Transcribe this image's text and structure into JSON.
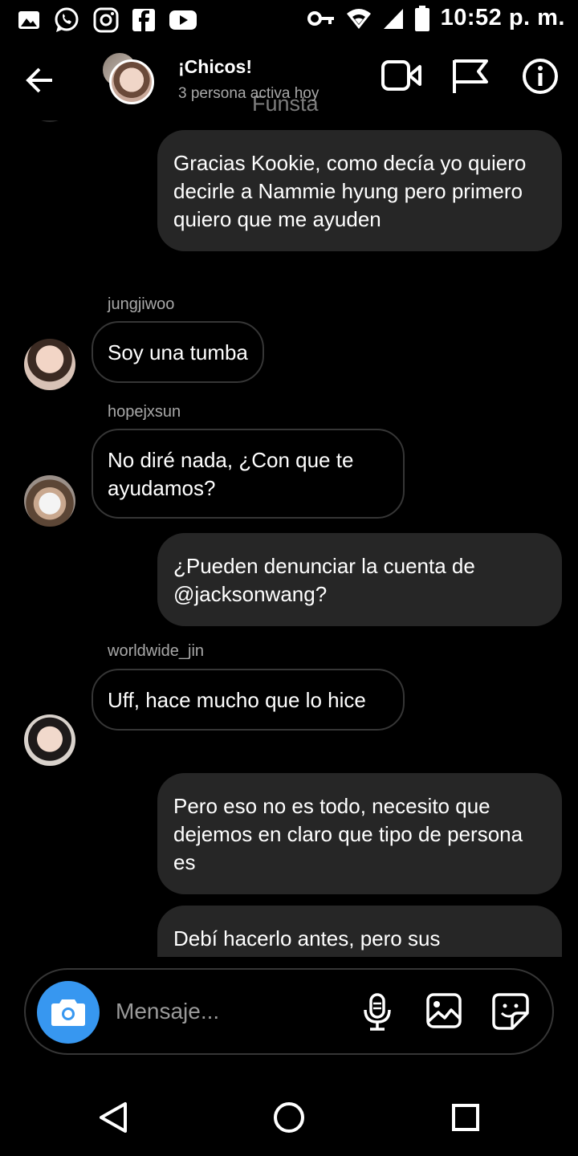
{
  "status_bar": {
    "time": "10:52 p. m.",
    "left_icons": [
      "gallery-notification-icon",
      "whatsapp-icon",
      "instagram-icon",
      "facebook-icon",
      "youtube-icon"
    ],
    "right_icons": [
      "key-icon",
      "wifi-icon",
      "signal-icon",
      "battery-icon"
    ]
  },
  "header": {
    "title": "¡Chicos!",
    "subtitle": "3 persona activa hoy",
    "ghost_text": "Funsta"
  },
  "messages": [
    {
      "type": "outgoing",
      "text": "Gracias Kookie, como decía yo quiero decirle a Nammie hyung pero primero quiero que me ayuden"
    },
    {
      "type": "incoming",
      "sender": "jungjiwoo",
      "text": "Soy una tumba"
    },
    {
      "type": "incoming",
      "sender": "hopejxsun",
      "text": "No diré nada, ¿Con que te ayudamos?"
    },
    {
      "type": "outgoing",
      "text": "¿Pueden denunciar la cuenta de @jacksonwang?"
    },
    {
      "type": "incoming",
      "sender": "worldwide_jin",
      "text": "Uff, hace mucho que lo hice"
    },
    {
      "type": "outgoing",
      "text": "Pero eso no es todo, necesito que dejemos en claro que tipo de persona es"
    },
    {
      "type": "outgoing",
      "text": "Debí hacerlo antes, pero sus"
    }
  ],
  "composer": {
    "placeholder": "Mensaje..."
  },
  "colors": {
    "background": "#000000",
    "outgoing_bubble": "#262626",
    "incoming_border": "#363636",
    "camera_button": "#3797f0",
    "secondary_text": "#a8a8a8"
  }
}
